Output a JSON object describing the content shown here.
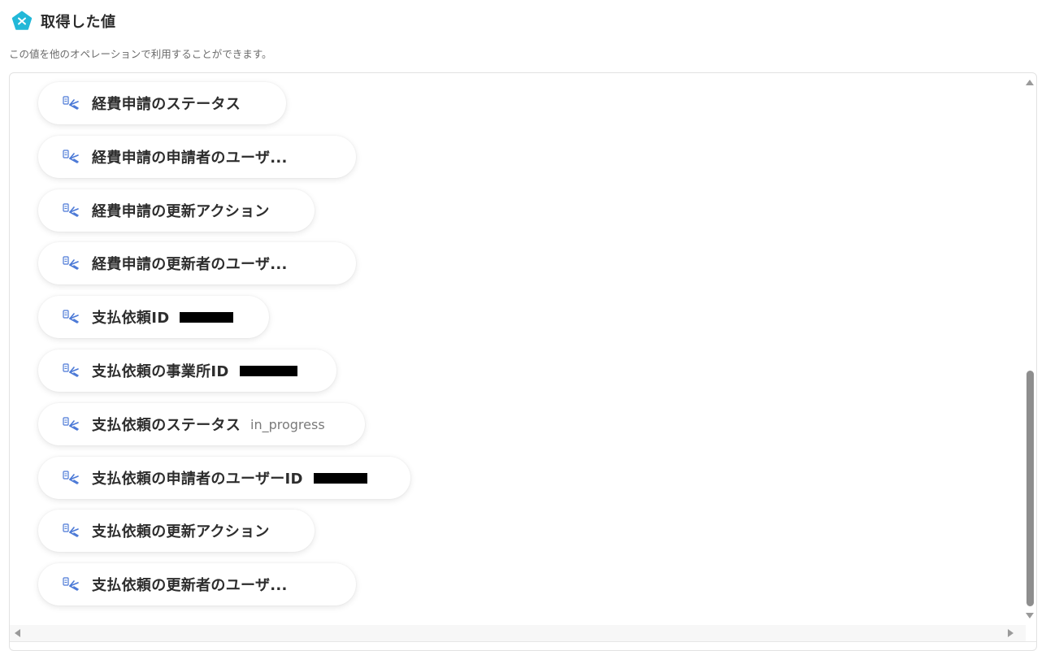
{
  "header": {
    "title": "取得した値",
    "logo_icon": "yoom-pentagon-logo-icon",
    "logo_color": "#22b8d8"
  },
  "subtitle": "この値を他のオペレーションで利用することができます。",
  "items": [
    {
      "label": "経費申請のステータス",
      "value": "",
      "redacted": false
    },
    {
      "label": "経費申請の申請者のユーザ...",
      "value": "",
      "redacted": false
    },
    {
      "label": "経費申請の更新アクション",
      "value": "",
      "redacted": false
    },
    {
      "label": "経費申請の更新者のユーザ...",
      "value": "",
      "redacted": false
    },
    {
      "label": "支払依頼ID",
      "value": "",
      "redacted": true
    },
    {
      "label": "支払依頼の事業所ID",
      "value": "",
      "redacted": true
    },
    {
      "label": "支払依頼のステータス",
      "value": "in_progress",
      "redacted": false
    },
    {
      "label": "支払依頼の申請者のユーザーID",
      "value": "",
      "redacted": true
    },
    {
      "label": "支払依頼の更新アクション",
      "value": "",
      "redacted": false
    },
    {
      "label": "支払依頼の更新者のユーザ...",
      "value": "",
      "redacted": false
    }
  ],
  "item_icon": "field-output-icon",
  "colors": {
    "accent": "#22b8d8",
    "icon_blue": "#4a78d6",
    "text": "#2d2d2d",
    "muted": "#7a7a7a"
  }
}
